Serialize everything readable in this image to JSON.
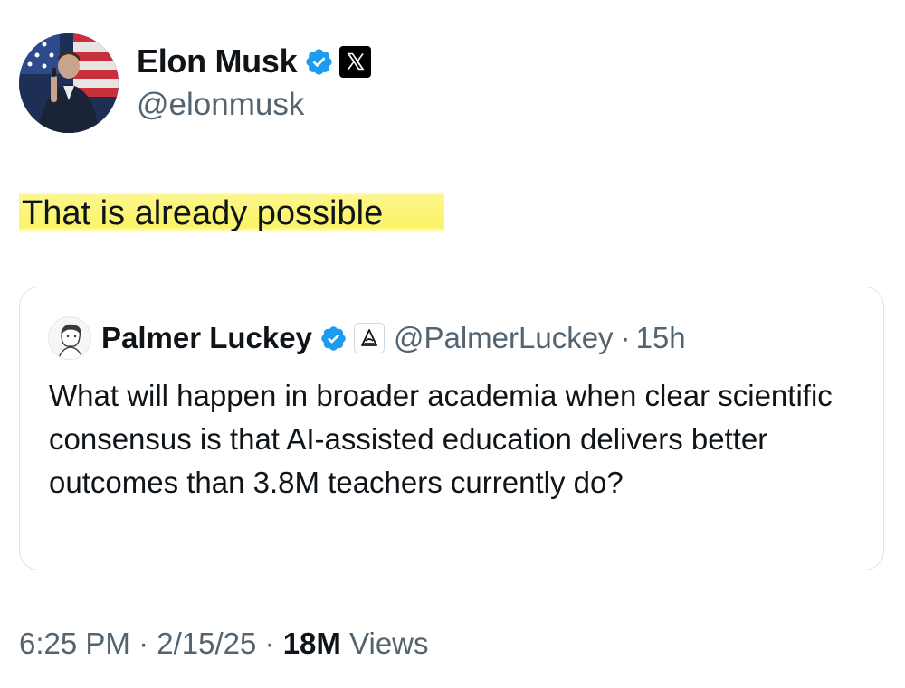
{
  "author": {
    "name": "Elon Musk",
    "handle": "@elonmusk",
    "verified_icon": "verified-badge-icon",
    "affiliation_icon": "x-logo-icon"
  },
  "tweet": {
    "text": "That is already possible",
    "highlight_color": "#fbf466"
  },
  "quoted_tweet": {
    "name": "Palmer Luckey",
    "handle": "@PalmerLuckey",
    "separator": "·",
    "time": "15h",
    "text": "What will happen in broader academia when clear scientific consensus is that AI-assisted education delivers better outcomes than 3.8M teachers currently do?",
    "affiliation_icon": "anduril-logo-icon"
  },
  "meta": {
    "time": "6:25 PM",
    "sep1": "·",
    "date": "2/15/25",
    "sep2": "·",
    "views_count": "18M",
    "views_label": "Views"
  },
  "colors": {
    "verified_blue": "#1d9bf0",
    "secondary_text": "#536471",
    "primary_text": "#0f1419"
  }
}
